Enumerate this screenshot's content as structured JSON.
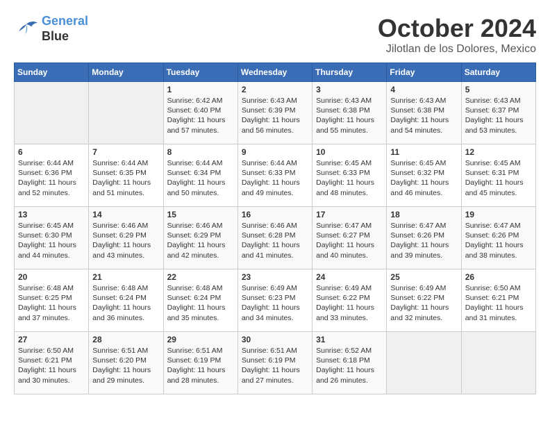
{
  "header": {
    "logo_line1": "General",
    "logo_line2": "Blue",
    "month_title": "October 2024",
    "location": "Jilotlan de los Dolores, Mexico"
  },
  "weekdays": [
    "Sunday",
    "Monday",
    "Tuesday",
    "Wednesday",
    "Thursday",
    "Friday",
    "Saturday"
  ],
  "weeks": [
    [
      {
        "day": "",
        "sunrise": "",
        "sunset": "",
        "daylight": ""
      },
      {
        "day": "",
        "sunrise": "",
        "sunset": "",
        "daylight": ""
      },
      {
        "day": "1",
        "sunrise": "Sunrise: 6:42 AM",
        "sunset": "Sunset: 6:40 PM",
        "daylight": "Daylight: 11 hours and 57 minutes."
      },
      {
        "day": "2",
        "sunrise": "Sunrise: 6:43 AM",
        "sunset": "Sunset: 6:39 PM",
        "daylight": "Daylight: 11 hours and 56 minutes."
      },
      {
        "day": "3",
        "sunrise": "Sunrise: 6:43 AM",
        "sunset": "Sunset: 6:38 PM",
        "daylight": "Daylight: 11 hours and 55 minutes."
      },
      {
        "day": "4",
        "sunrise": "Sunrise: 6:43 AM",
        "sunset": "Sunset: 6:38 PM",
        "daylight": "Daylight: 11 hours and 54 minutes."
      },
      {
        "day": "5",
        "sunrise": "Sunrise: 6:43 AM",
        "sunset": "Sunset: 6:37 PM",
        "daylight": "Daylight: 11 hours and 53 minutes."
      }
    ],
    [
      {
        "day": "6",
        "sunrise": "Sunrise: 6:44 AM",
        "sunset": "Sunset: 6:36 PM",
        "daylight": "Daylight: 11 hours and 52 minutes."
      },
      {
        "day": "7",
        "sunrise": "Sunrise: 6:44 AM",
        "sunset": "Sunset: 6:35 PM",
        "daylight": "Daylight: 11 hours and 51 minutes."
      },
      {
        "day": "8",
        "sunrise": "Sunrise: 6:44 AM",
        "sunset": "Sunset: 6:34 PM",
        "daylight": "Daylight: 11 hours and 50 minutes."
      },
      {
        "day": "9",
        "sunrise": "Sunrise: 6:44 AM",
        "sunset": "Sunset: 6:33 PM",
        "daylight": "Daylight: 11 hours and 49 minutes."
      },
      {
        "day": "10",
        "sunrise": "Sunrise: 6:45 AM",
        "sunset": "Sunset: 6:33 PM",
        "daylight": "Daylight: 11 hours and 48 minutes."
      },
      {
        "day": "11",
        "sunrise": "Sunrise: 6:45 AM",
        "sunset": "Sunset: 6:32 PM",
        "daylight": "Daylight: 11 hours and 46 minutes."
      },
      {
        "day": "12",
        "sunrise": "Sunrise: 6:45 AM",
        "sunset": "Sunset: 6:31 PM",
        "daylight": "Daylight: 11 hours and 45 minutes."
      }
    ],
    [
      {
        "day": "13",
        "sunrise": "Sunrise: 6:45 AM",
        "sunset": "Sunset: 6:30 PM",
        "daylight": "Daylight: 11 hours and 44 minutes."
      },
      {
        "day": "14",
        "sunrise": "Sunrise: 6:46 AM",
        "sunset": "Sunset: 6:29 PM",
        "daylight": "Daylight: 11 hours and 43 minutes."
      },
      {
        "day": "15",
        "sunrise": "Sunrise: 6:46 AM",
        "sunset": "Sunset: 6:29 PM",
        "daylight": "Daylight: 11 hours and 42 minutes."
      },
      {
        "day": "16",
        "sunrise": "Sunrise: 6:46 AM",
        "sunset": "Sunset: 6:28 PM",
        "daylight": "Daylight: 11 hours and 41 minutes."
      },
      {
        "day": "17",
        "sunrise": "Sunrise: 6:47 AM",
        "sunset": "Sunset: 6:27 PM",
        "daylight": "Daylight: 11 hours and 40 minutes."
      },
      {
        "day": "18",
        "sunrise": "Sunrise: 6:47 AM",
        "sunset": "Sunset: 6:26 PM",
        "daylight": "Daylight: 11 hours and 39 minutes."
      },
      {
        "day": "19",
        "sunrise": "Sunrise: 6:47 AM",
        "sunset": "Sunset: 6:26 PM",
        "daylight": "Daylight: 11 hours and 38 minutes."
      }
    ],
    [
      {
        "day": "20",
        "sunrise": "Sunrise: 6:48 AM",
        "sunset": "Sunset: 6:25 PM",
        "daylight": "Daylight: 11 hours and 37 minutes."
      },
      {
        "day": "21",
        "sunrise": "Sunrise: 6:48 AM",
        "sunset": "Sunset: 6:24 PM",
        "daylight": "Daylight: 11 hours and 36 minutes."
      },
      {
        "day": "22",
        "sunrise": "Sunrise: 6:48 AM",
        "sunset": "Sunset: 6:24 PM",
        "daylight": "Daylight: 11 hours and 35 minutes."
      },
      {
        "day": "23",
        "sunrise": "Sunrise: 6:49 AM",
        "sunset": "Sunset: 6:23 PM",
        "daylight": "Daylight: 11 hours and 34 minutes."
      },
      {
        "day": "24",
        "sunrise": "Sunrise: 6:49 AM",
        "sunset": "Sunset: 6:22 PM",
        "daylight": "Daylight: 11 hours and 33 minutes."
      },
      {
        "day": "25",
        "sunrise": "Sunrise: 6:49 AM",
        "sunset": "Sunset: 6:22 PM",
        "daylight": "Daylight: 11 hours and 32 minutes."
      },
      {
        "day": "26",
        "sunrise": "Sunrise: 6:50 AM",
        "sunset": "Sunset: 6:21 PM",
        "daylight": "Daylight: 11 hours and 31 minutes."
      }
    ],
    [
      {
        "day": "27",
        "sunrise": "Sunrise: 6:50 AM",
        "sunset": "Sunset: 6:21 PM",
        "daylight": "Daylight: 11 hours and 30 minutes."
      },
      {
        "day": "28",
        "sunrise": "Sunrise: 6:51 AM",
        "sunset": "Sunset: 6:20 PM",
        "daylight": "Daylight: 11 hours and 29 minutes."
      },
      {
        "day": "29",
        "sunrise": "Sunrise: 6:51 AM",
        "sunset": "Sunset: 6:19 PM",
        "daylight": "Daylight: 11 hours and 28 minutes."
      },
      {
        "day": "30",
        "sunrise": "Sunrise: 6:51 AM",
        "sunset": "Sunset: 6:19 PM",
        "daylight": "Daylight: 11 hours and 27 minutes."
      },
      {
        "day": "31",
        "sunrise": "Sunrise: 6:52 AM",
        "sunset": "Sunset: 6:18 PM",
        "daylight": "Daylight: 11 hours and 26 minutes."
      },
      {
        "day": "",
        "sunrise": "",
        "sunset": "",
        "daylight": ""
      },
      {
        "day": "",
        "sunrise": "",
        "sunset": "",
        "daylight": ""
      }
    ]
  ]
}
